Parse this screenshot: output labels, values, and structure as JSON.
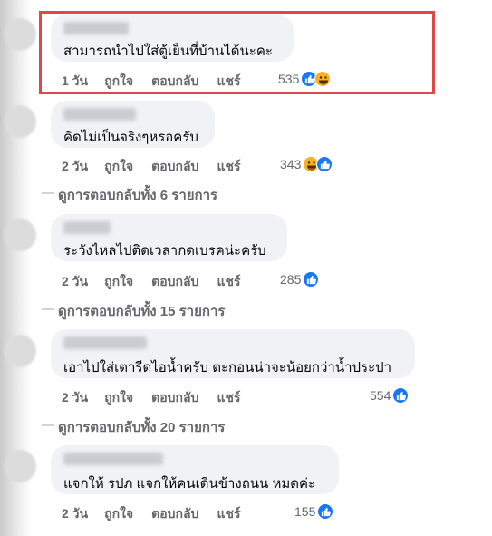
{
  "comments": [
    {
      "text": "สามารถนำไปใส่ตู้เย็นที่บ้านได้นะคะ",
      "actions": {
        "time": "1 วัน",
        "like": "ถูกใจ",
        "reply": "ตอบกลับ",
        "share": "แชร์"
      },
      "reaction_count": "535",
      "reactions": [
        "like-icon",
        "haha-icon"
      ],
      "highlighted": true
    },
    {
      "text": "คิดไม่เป็นจริงๆหรอครับ",
      "actions": {
        "time": "2 วัน",
        "like": "ถูกใจ",
        "reply": "ตอบกลับ",
        "share": "แชร์"
      },
      "reaction_count": "343",
      "reactions": [
        "haha-icon",
        "like-icon"
      ],
      "replies_link": "ดูการตอบกลับทั้ง 6 รายการ"
    },
    {
      "text": "ระวังไหลไปติดเวลากดเบรคน่ะครับ",
      "actions": {
        "time": "2 วัน",
        "like": "ถูกใจ",
        "reply": "ตอบกลับ",
        "share": "แชร์"
      },
      "reaction_count": "285",
      "reactions": [
        "like-icon"
      ],
      "replies_link": "ดูการตอบกลับทั้ง 15 รายการ"
    },
    {
      "text": "เอาไปใส่เตารีดไอน้ำครับ ตะกอนน่าจะน้อยกว่าน้ำประปา",
      "actions": {
        "time": "2 วัน",
        "like": "ถูกใจ",
        "reply": "ตอบกลับ",
        "share": "แชร์"
      },
      "reaction_count": "554",
      "reactions": [
        "like-icon"
      ],
      "replies_link": "ดูการตอบกลับทั้ง 20 รายการ"
    },
    {
      "text": "แจกให้ รปภ แจกให้คนเดินข้างถนน หมดค่ะ",
      "actions": {
        "time": "2 วัน",
        "like": "ถูกใจ",
        "reply": "ตอบกลับ",
        "share": "แชร์"
      },
      "reaction_count": "155",
      "reactions": [
        "like-icon"
      ]
    }
  ],
  "colors": {
    "bubble": "#f0f2f5",
    "secondary_text": "#65676b",
    "like_blue": "#1877f2",
    "haha_yellow": "#f7b125",
    "highlight_red": "#e04848"
  }
}
